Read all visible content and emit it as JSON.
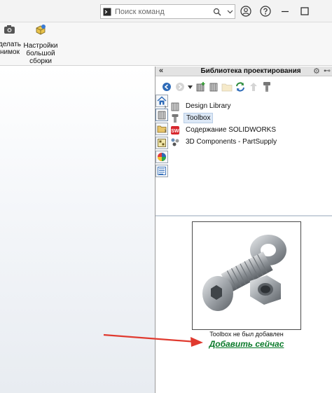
{
  "titlebar": {
    "search_placeholder": "Поиск команд",
    "icons": [
      "terminal-prompt-icon",
      "search-icon",
      "chevron-down-icon",
      "account-icon",
      "help-icon",
      "minimize-icon",
      "maximize-icon"
    ]
  },
  "ribbon": {
    "snapshot_label": "делать\nнимок",
    "large_assembly_label": "Настройки\nбольшой\nсборки"
  },
  "pane": {
    "title": "Библиотека проектирования",
    "collapse_glyph": "«",
    "tree": [
      {
        "label": "Design Library",
        "expandable": true,
        "icon": "design-library-icon"
      },
      {
        "label": "Toolbox",
        "expandable": false,
        "icon": "toolbox-icon",
        "selected": true
      },
      {
        "label": "Содержание SOLIDWORKS",
        "expandable": true,
        "icon": "solidworks-content-icon"
      },
      {
        "label": "3D Components - PartSupply",
        "expandable": false,
        "icon": "partsupply-icon"
      }
    ],
    "preview_caption": "Toolbox не был добавлен",
    "add_link": "Добавить сейчас"
  },
  "colors": {
    "link_green": "#0a7a2a",
    "arrow_red": "#e03a2f",
    "selection": "#dce8f6"
  }
}
